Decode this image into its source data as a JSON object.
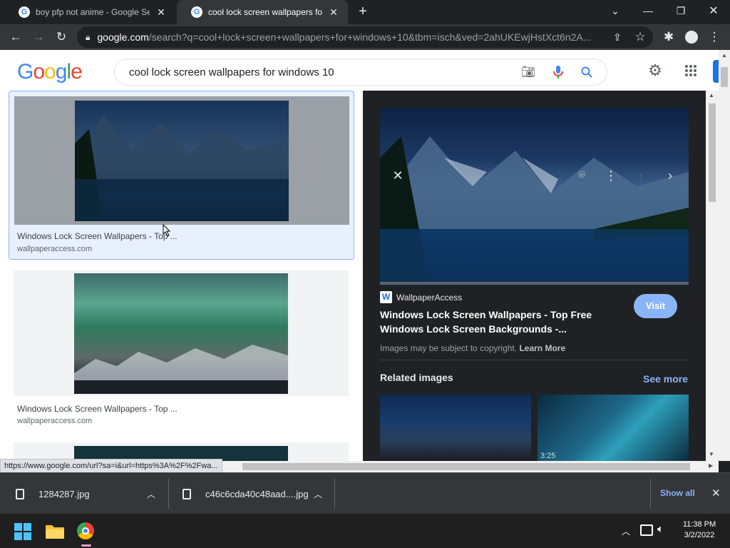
{
  "tabs": [
    {
      "title": "boy pfp not anime - Google Sear"
    },
    {
      "title": "cool lock screen wallpapers for w"
    }
  ],
  "address": {
    "host": "google.com",
    "path": "/search?q=cool+lock+screen+wallpapers+for+windows+10&tbm=isch&ved=2ahUKEwjHstXct6n2A..."
  },
  "search": {
    "logo": "Google",
    "query": "cool lock screen wallpapers for windows 10"
  },
  "results": [
    {
      "title": "Windows Lock Screen Wallpapers - Top ...",
      "source": "wallpaperaccess.com"
    },
    {
      "title": "Windows Lock Screen Wallpapers - Top ...",
      "source": "wallpaperaccess.com"
    }
  ],
  "panel": {
    "source_name": "WallpaperAccess",
    "source_initial": "W",
    "title_line1": "Windows Lock Screen Wallpapers - Top Free",
    "title_line2": "Windows Lock Screen Backgrounds -...",
    "visit_label": "Visit",
    "copyright_text": "Images may be subject to copyright.",
    "learn_more": "Learn More",
    "related_heading": "Related images",
    "see_more": "See more",
    "related_badge": "3:25"
  },
  "status_url": "https://www.google.com/url?sa=i&url=https%3A%2F%2Fwa...",
  "downloads": {
    "items": [
      {
        "name": "1284287.jpg"
      },
      {
        "name": "c46c6cda40c48aad....jpg"
      }
    ],
    "show_all": "Show all"
  },
  "clock": {
    "time": "11:38 PM",
    "date": "3/2/2022"
  },
  "colors": {
    "accent_blue": "#8ab4f8",
    "visit_button": "#8ab4f8",
    "selected_card": "#e8f0fe"
  }
}
